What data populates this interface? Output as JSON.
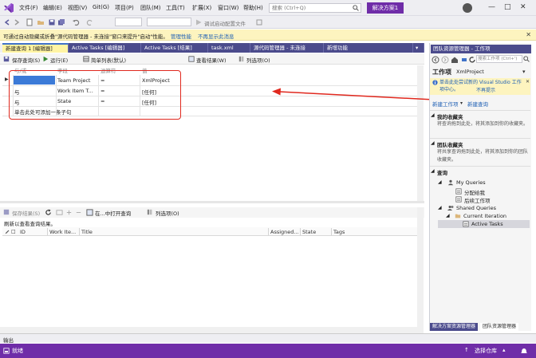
{
  "menu": {
    "items": [
      "文件(F)",
      "编辑(E)",
      "视图(V)",
      "Git(G)",
      "项目(P)",
      "团队(M)",
      "工具(T)",
      "扩展(X)",
      "窗口(W)",
      "帮助(H)"
    ],
    "search_placeholder": "搜索 (Ctrl+Q)",
    "solution_label": "解决方案1"
  },
  "toolbar": {
    "debug_target": "调试启动配置文件"
  },
  "infobar": {
    "message": "可通过自动隐藏或折叠\"源代码管理器 - 未连接\"窗口来提升\"启动\"性能。",
    "link_manage": "管理性能",
    "link_dismiss": "不再显示此消息"
  },
  "doc_tabs": [
    {
      "label": "新建查询 1 [编辑器]",
      "active": true
    },
    {
      "label": "Active Tasks [编辑器]",
      "active": false
    },
    {
      "label": "Active Tasks [结果]",
      "active": false
    },
    {
      "label": "task.xml",
      "active": false
    },
    {
      "label": "源代码管理器 - 未连接",
      "active": false
    },
    {
      "label": "新增功能",
      "active": false
    }
  ],
  "query_toolbar": {
    "save": "保存查询(S)",
    "run": "运行(E)",
    "type": "简单列表(默认)",
    "view_results": "查看结果(W)",
    "columns": "列选项(O)"
  },
  "query_grid": {
    "headers": [
      "与/或",
      "字段",
      "运算符",
      "值"
    ],
    "rows": [
      {
        "andor": "",
        "field": "Team Project",
        "op": "=",
        "value": "XmlProject"
      },
      {
        "andor": "与",
        "field": "Work Item T...",
        "op": "=",
        "value": "[任何]"
      },
      {
        "andor": "与",
        "field": "State",
        "op": "=",
        "value": "[任何]"
      }
    ],
    "add_clause": "单击此处可添加一条子句"
  },
  "results": {
    "toolbar": {
      "save": "保存结果(S)",
      "open": "在...中打开查询",
      "columns": "列选项(O)"
    },
    "message": "刷新以查看查询结果。",
    "columns": [
      "ID",
      "Work Ite...",
      "Title",
      "Assigned...",
      "State",
      "Tags"
    ]
  },
  "team_explorer": {
    "panel_title": "团队资源管理器 - 工作项",
    "search_placeholder": "搜索工作项 (Ctrl+')",
    "header": "工作项",
    "project": "XmlProject",
    "notice_text": "单击此处尝试新的 Visual Studio 工作项中心。",
    "notice_dismiss": "不再提示",
    "new_work_item": "新建工作项",
    "new_query": "新建查询",
    "favorites_title": "我的收藏夹",
    "favorites_text": "将查询拖到此处，将其添加到你的收藏夹。",
    "team_favorites_title": "团队收藏夹",
    "team_favorites_text": "将共享查询拖到此处，将其添加到你的团队收藏夹。",
    "queries_title": "查询",
    "tree": [
      {
        "label": "My Queries",
        "level": 1,
        "icon": "person"
      },
      {
        "label": "分配给我",
        "level": 2,
        "icon": "query"
      },
      {
        "label": "后续工作项",
        "level": 2,
        "icon": "query"
      },
      {
        "label": "Shared Queries",
        "level": 1,
        "icon": "people"
      },
      {
        "label": "Current Iteration",
        "level": 2,
        "icon": "folder"
      },
      {
        "label": "Active Tasks",
        "level": 3,
        "icon": "query"
      }
    ],
    "bottom_tabs": [
      "解决方案资源管理器",
      "团队资源管理器"
    ]
  },
  "output_label": "输出",
  "status": {
    "ready": "就绪",
    "repo": "选择仓库"
  },
  "colors": {
    "accent": "#6f2da8",
    "tab_active": "#fff4a3",
    "tab_inactive": "#4b4b8c",
    "annotation_red": "#e0281e"
  }
}
